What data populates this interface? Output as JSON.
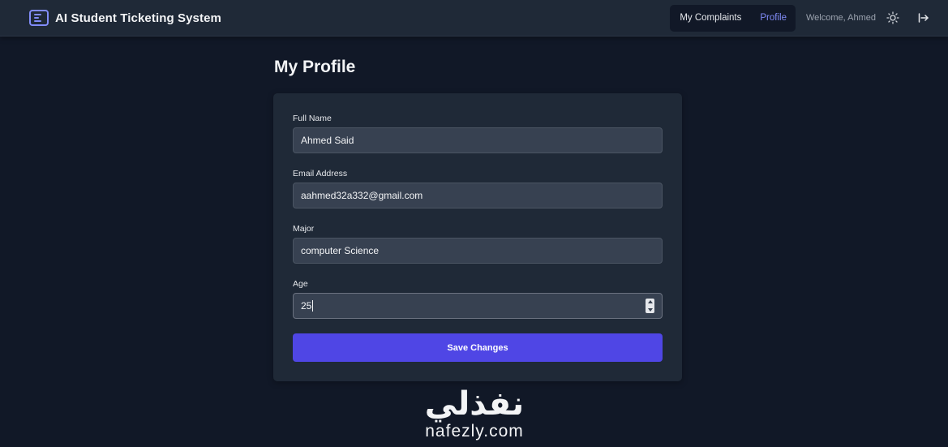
{
  "app": {
    "title": "AI Student Ticketing System"
  },
  "nav": {
    "links": [
      {
        "label": "My Complaints",
        "active": false
      },
      {
        "label": "Profile",
        "active": true
      }
    ],
    "welcome": "Welcome, Ahmed"
  },
  "page": {
    "title": "My Profile"
  },
  "form": {
    "full_name": {
      "label": "Full Name",
      "value": "Ahmed Said"
    },
    "email": {
      "label": "Email Address",
      "value": "aahmed32a332@gmail.com"
    },
    "major": {
      "label": "Major",
      "value": "computer Science"
    },
    "age": {
      "label": "Age",
      "value": "25"
    },
    "save_label": "Save Changes"
  },
  "watermark": {
    "arabic": "نفذلي",
    "latin": "nafezly.com"
  },
  "colors": {
    "background": "#111827",
    "surface": "#1f2937",
    "input": "#374151",
    "accent": "#4f46e5",
    "active_link": "#818cf8"
  },
  "icons": {
    "brand": "document-lines-icon",
    "theme": "sun-icon",
    "logout": "logout-arrow-icon",
    "stepper": "number-stepper-arrows"
  }
}
